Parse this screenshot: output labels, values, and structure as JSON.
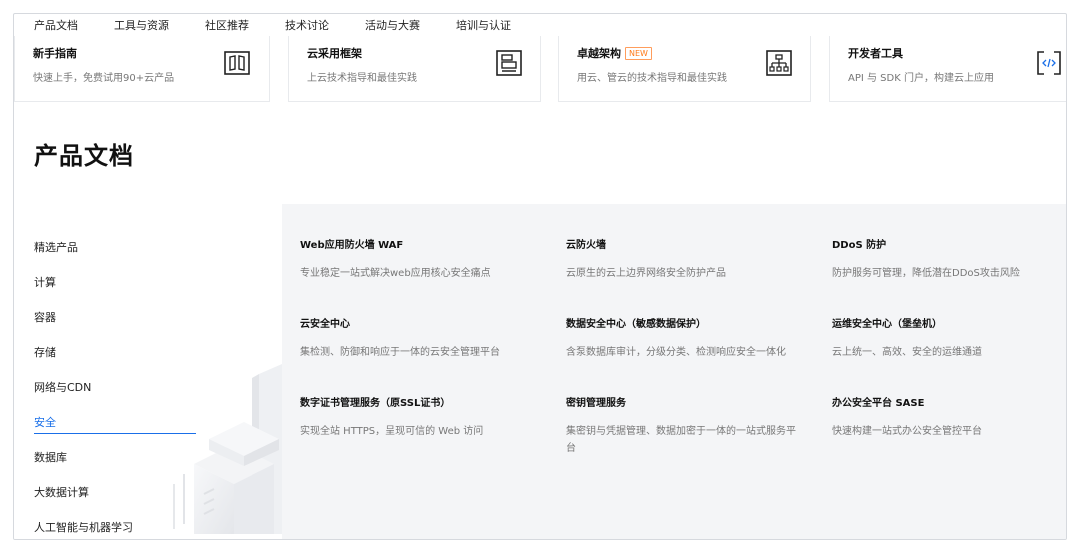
{
  "topnav": [
    "产品文档",
    "工具与资源",
    "社区推荐",
    "技术讨论",
    "活动与大赛",
    "培训与认证"
  ],
  "cards": [
    {
      "title": "新手指南",
      "badge": "",
      "desc": "快速上手，免费试用90+云产品",
      "icon": "book-icon"
    },
    {
      "title": "云采用框架",
      "badge": "",
      "desc": "上云技术指导和最佳实践",
      "icon": "framework-icon"
    },
    {
      "title": "卓越架构",
      "badge": "NEW",
      "desc": "用云、管云的技术指导和最佳实践",
      "icon": "architecture-icon"
    },
    {
      "title": "开发者工具",
      "badge": "",
      "desc": "API 与 SDK 门户，构建云上应用",
      "icon": "code-icon"
    }
  ],
  "page_title": "产品文档",
  "sidebar": {
    "items": [
      "精选产品",
      "计算",
      "容器",
      "存储",
      "网络与CDN",
      "安全",
      "数据库",
      "大数据计算",
      "人工智能与机器学习"
    ],
    "active": "安全"
  },
  "products": [
    {
      "name": "Web应用防火墙 WAF",
      "desc": "专业稳定一站式解决web应用核心安全痛点"
    },
    {
      "name": "云防火墙",
      "desc": "云原生的云上边界网络安全防护产品"
    },
    {
      "name": "DDoS 防护",
      "desc": "防护服务可管理，降低潜在DDoS攻击风险"
    },
    {
      "name": "云安全中心",
      "desc": "集检测、防御和响应于一体的云安全管理平台"
    },
    {
      "name": "数据安全中心（敏感数据保护）",
      "desc": "含泵数据库审计，分级分类、检测响应安全一体化"
    },
    {
      "name": "运维安全中心（堡垒机）",
      "desc": "云上统一、高效、安全的运维通道"
    },
    {
      "name": "数字证书管理服务（原SSL证书）",
      "desc": "实现全站 HTTPS，呈现可信的 Web 访问"
    },
    {
      "name": "密钥管理服务",
      "desc": "集密钥与凭据管理、数据加密于一体的一站式服务平台"
    },
    {
      "name": "办公安全平台 SASE",
      "desc": "快速构建一站式办公安全管控平台"
    }
  ],
  "colors": {
    "accent": "#1a6fe8",
    "badge": "#ff7a1a"
  }
}
